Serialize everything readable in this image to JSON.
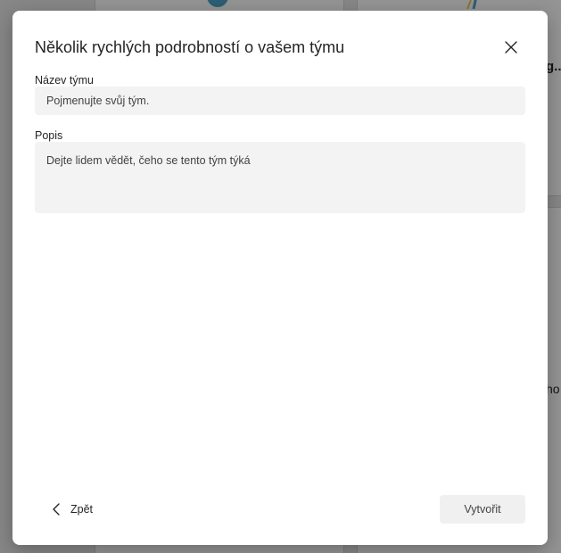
{
  "background": {
    "partial_text_1": "g...",
    "partial_text_2": "ho"
  },
  "dialog": {
    "title": "Několik rychlých podrobností o vašem týmu",
    "close_icon": "close-icon",
    "fields": {
      "name": {
        "label": "Název týmu",
        "placeholder": "Pojmenujte svůj tým.",
        "value": ""
      },
      "description": {
        "label": "Popis",
        "placeholder": "Dejte lidem vědět, čeho se tento tým týká",
        "value": ""
      }
    },
    "footer": {
      "back_label": "Zpět",
      "back_icon": "chevron-left-icon",
      "create_label": "Vytvořit"
    }
  },
  "colors": {
    "input_background": "#f3f3f3",
    "disabled_button_background": "#f0f0f0",
    "text": "#242424"
  }
}
